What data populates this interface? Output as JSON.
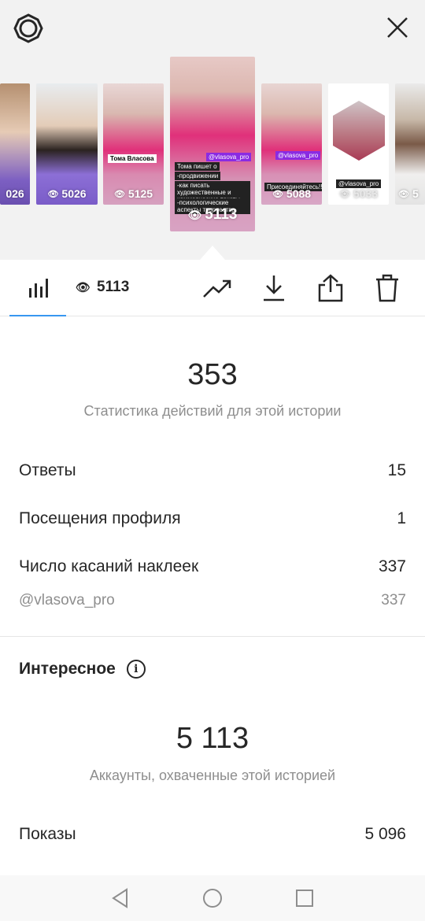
{
  "stories": [
    {
      "views": "026",
      "tags": []
    },
    {
      "views": "5026",
      "tags": []
    },
    {
      "views": "5125",
      "tags": [
        "Тома Власова"
      ]
    },
    {
      "views": "5113",
      "tags": [
        "@vlasova_pro",
        "Тома пишет о",
        "-продвижении",
        "-как писать художественные и коммерческие тексты",
        "-психологические аспекты творчества"
      ]
    },
    {
      "views": "5088",
      "tags": [
        "@vlasova_pro",
        "Присоединяйтесь!!!"
      ]
    },
    {
      "views": "5033",
      "tags": [
        "@vlasova_pro"
      ]
    },
    {
      "views": "5",
      "tags": []
    }
  ],
  "toolbar": {
    "viewer_count": "5113"
  },
  "actions": {
    "total": "353",
    "total_caption": "Статистика действий для этой истории",
    "rows": [
      {
        "label": "Ответы",
        "value": "15"
      },
      {
        "label": "Посещения профиля",
        "value": "1"
      },
      {
        "label": "Число касаний наклеек",
        "value": "337"
      }
    ],
    "sticker_detail": {
      "label": "@vlasova_pro",
      "value": "337"
    }
  },
  "discovery": {
    "title": "Интересное",
    "reach": "5 113",
    "reach_caption": "Аккаунты, охваченные этой историей",
    "impressions_label": "Показы",
    "impressions_value": "5 096"
  },
  "colors": {
    "accent": "#3897f0",
    "pink": "#e0307a",
    "purple": "#8a2be2"
  }
}
